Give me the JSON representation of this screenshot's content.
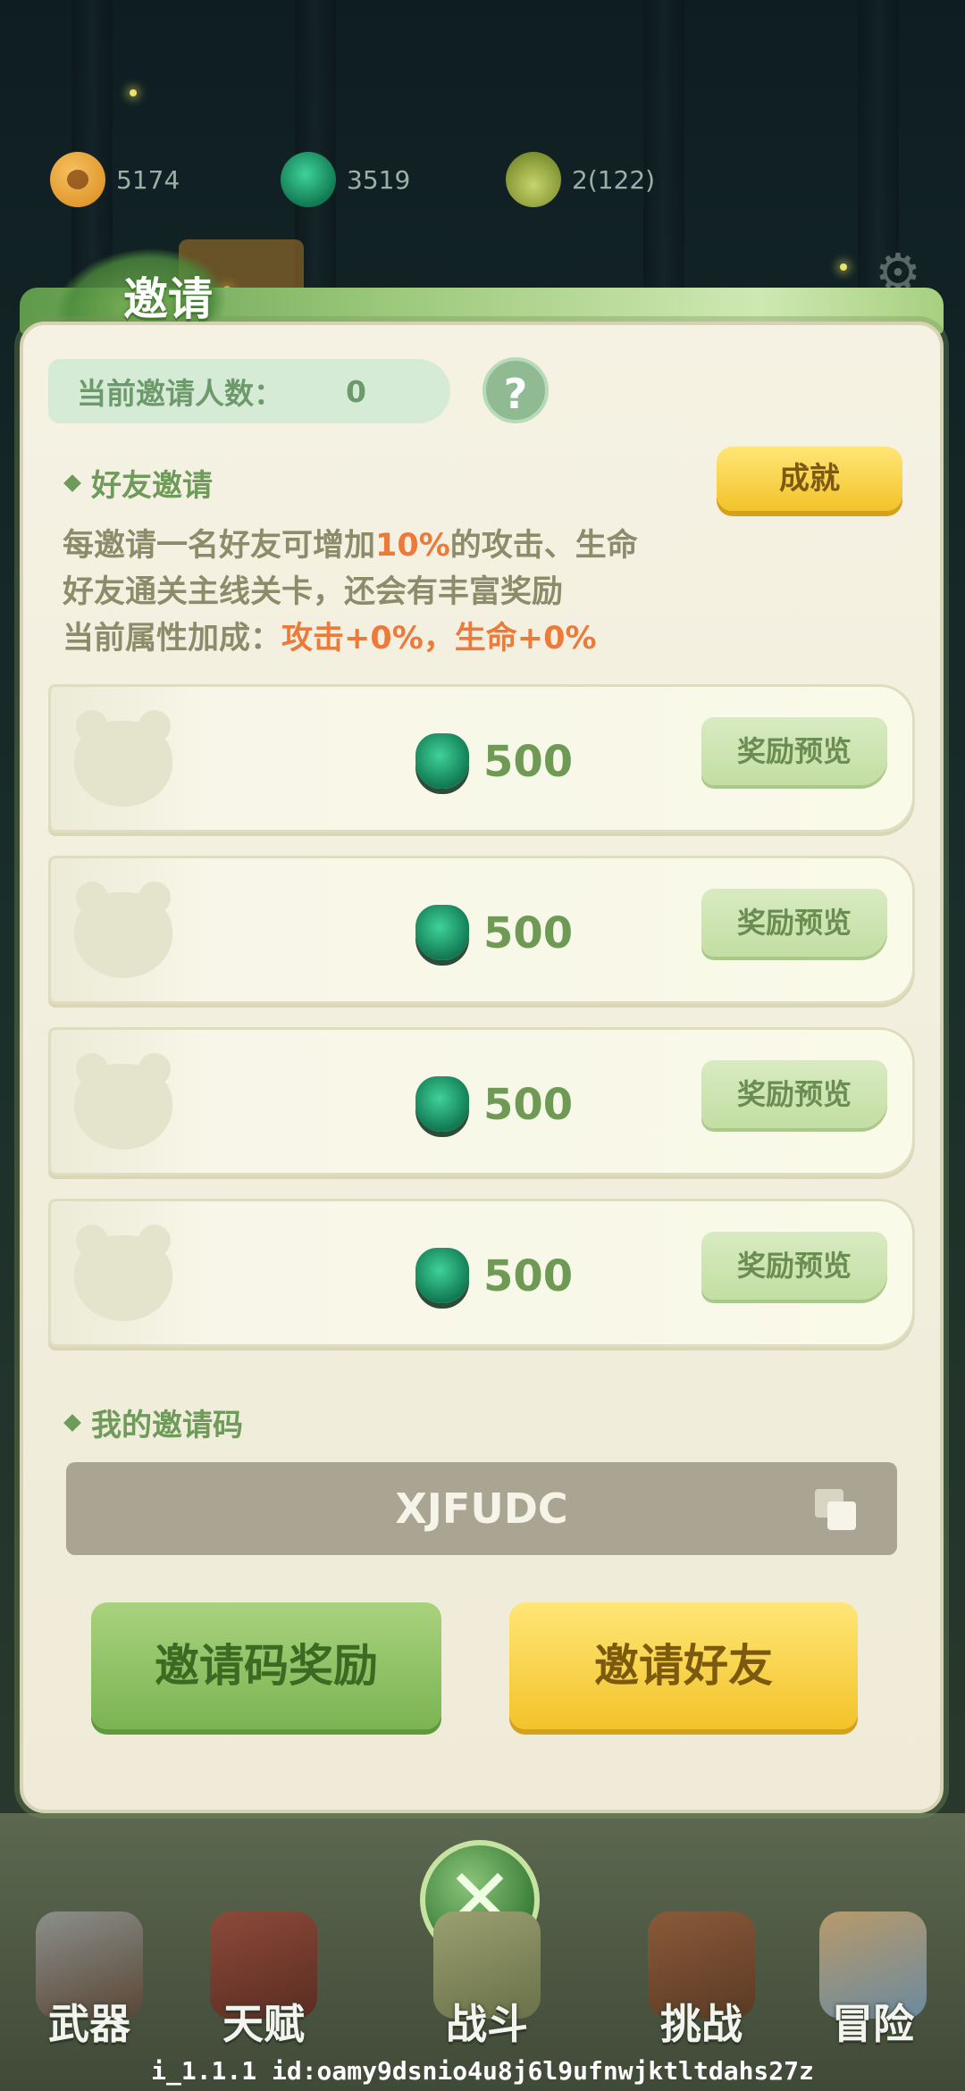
{
  "resources": [
    {
      "icon": "paw-coin-icon",
      "value": "5174"
    },
    {
      "icon": "green-gem-icon",
      "value": "3519"
    },
    {
      "icon": "bamboo-shoot-icon",
      "value": "2(122)"
    }
  ],
  "panel": {
    "title": "邀请",
    "invite_count_label": "当前邀请人数：",
    "invite_count": "0",
    "help_symbol": "?",
    "friend_section_title": "好友邀请",
    "achievement_button": "成就",
    "desc_line1_a": "每邀请一名好友可增加",
    "desc_line1_highlight": "10%",
    "desc_line1_b": "的攻击、生命",
    "desc_line2": "好友通关主线关卡，还会有丰富奖励",
    "desc_line3_a": "当前属性加成：",
    "desc_line3_highlight": "攻击+0%，生命+0%",
    "reward_rows": [
      {
        "amount": "500",
        "button": "奖励预览"
      },
      {
        "amount": "500",
        "button": "奖励预览"
      },
      {
        "amount": "500",
        "button": "奖励预览"
      },
      {
        "amount": "500",
        "button": "奖励预览"
      }
    ],
    "code_section_title": "我的邀请码",
    "invite_code": "XJFUDC",
    "code_reward_button": "邀请码奖励",
    "invite_friend_button": "邀请好友"
  },
  "nav": [
    {
      "label": "武器",
      "icon": "axe-icon"
    },
    {
      "label": "天赋",
      "icon": "book-icon"
    },
    {
      "label": "战斗",
      "icon": "battle-scroll-icon"
    },
    {
      "label": "挑战",
      "icon": "wooden-dummy-icon"
    },
    {
      "label": "冒险",
      "icon": "map-icon"
    }
  ],
  "close_symbol": "✕",
  "footer_id": "i_1.1.1 id:oamy9dsnio4u8j6l9ufnwjktltdahs27z",
  "colors": {
    "accent_green": "#6e9a5a",
    "highlight_orange": "#ec7a3a",
    "button_yellow": "#f3c32a"
  }
}
